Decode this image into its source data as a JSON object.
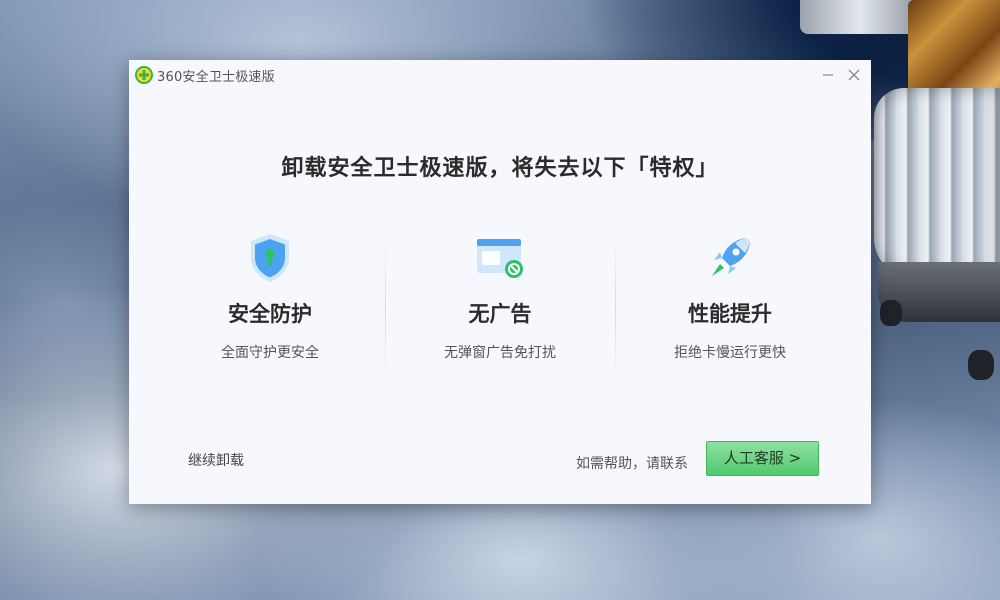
{
  "window": {
    "title": "360安全卫士极速版"
  },
  "dialog": {
    "headline": "卸载安全卫士极速版，将失去以下「特权」",
    "features": [
      {
        "title": "安全防护",
        "desc": "全面守护更安全",
        "icon": "shield-lock-icon"
      },
      {
        "title": "无广告",
        "desc": "无弹窗广告免打扰",
        "icon": "no-ads-window-icon"
      },
      {
        "title": "性能提升",
        "desc": "拒绝卡慢运行更快",
        "icon": "rocket-icon"
      }
    ],
    "continue_label": "继续卸载",
    "help_text": "如需帮助，请联系",
    "service_button": "人工客服 >"
  },
  "colors": {
    "accent_green": "#52c96d",
    "icon_blue": "#4ea3f0",
    "dialog_bg": "#f7f8fd"
  }
}
